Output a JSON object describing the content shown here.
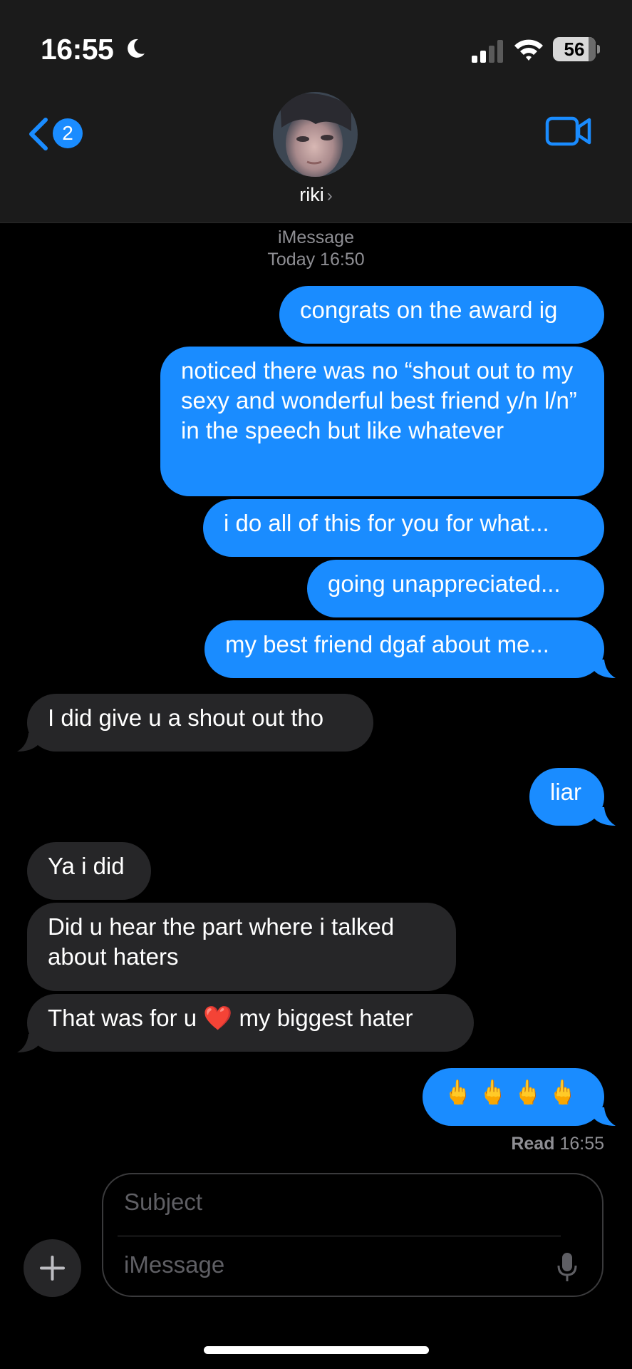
{
  "status_bar": {
    "time": "16:55",
    "battery_level": "56"
  },
  "header": {
    "back_badge_count": "2",
    "contact_name": "riki",
    "contact_chevron": "›"
  },
  "thread": {
    "service": "iMessage",
    "timestamp": "Today 16:50"
  },
  "messages": [
    {
      "sender": "me",
      "text": "congrats on the award ig"
    },
    {
      "sender": "me",
      "text": "noticed there was no “shout out to my sexy and wonderful best friend y/n l/n” in the speech but like whatever"
    },
    {
      "sender": "me",
      "text": "i do all of this for you for what..."
    },
    {
      "sender": "me",
      "text": "going unappreciated..."
    },
    {
      "sender": "me",
      "text": "my best friend dgaf about me..."
    },
    {
      "sender": "them",
      "text": "I did give u a shout out tho"
    },
    {
      "sender": "me",
      "text": "liar"
    },
    {
      "sender": "them",
      "text": "Ya i did"
    },
    {
      "sender": "them",
      "text": "Did u hear the part where i talked about haters"
    },
    {
      "sender": "them",
      "text_before": "That was for u",
      "emoji": "❤️",
      "text_after": "my biggest hater"
    },
    {
      "sender": "me",
      "text": "🖕🖕🖕🖕"
    }
  ],
  "read_receipt": {
    "label": "Read",
    "time": "16:55"
  },
  "compose": {
    "subject_placeholder": "Subject",
    "message_placeholder": "iMessage"
  },
  "colors": {
    "sent_bubble": "#1a8cff",
    "received_bubble": "#262628",
    "background": "#000000",
    "header_background": "#1b1b1b",
    "accent": "#1a8cff"
  },
  "icons": {
    "moon": "moon-icon",
    "signal": "cellular-signal-icon",
    "wifi": "wifi-icon",
    "battery": "battery-icon",
    "back": "chevron-left-icon",
    "video": "video-camera-icon",
    "plus": "plus-icon",
    "mic": "microphone-icon"
  }
}
